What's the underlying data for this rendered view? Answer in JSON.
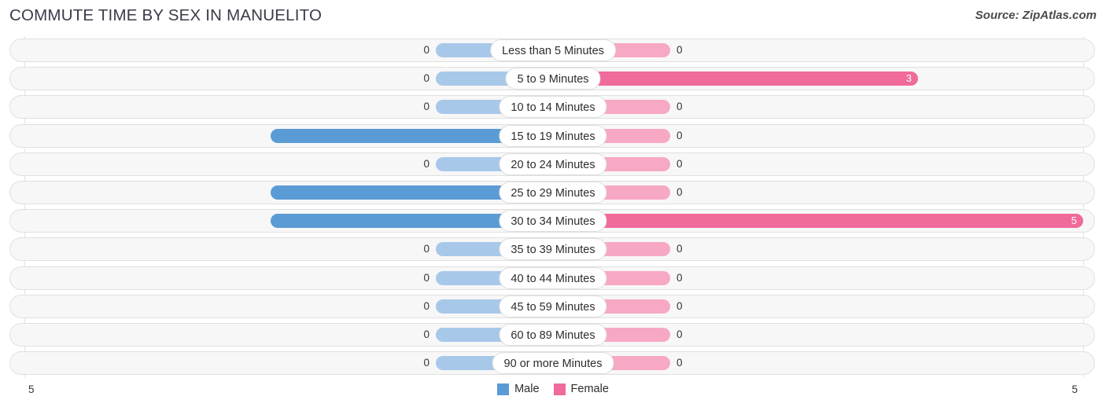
{
  "header": {
    "title": "COMMUTE TIME BY SEX IN MANUELITO",
    "source": "Source: ZipAtlas.com"
  },
  "legend": {
    "male_label": "Male",
    "female_label": "Female"
  },
  "axis": {
    "left_label": "5",
    "right_label": "5"
  },
  "colors": {
    "male_strong": "#5b9bd5",
    "male_light": "#a8c8ea",
    "female_strong": "#f06a9b",
    "female_light": "#f7a8c4",
    "track_fill": "#f7f7f7",
    "track_border": "#e0e0e0",
    "gridline": "#e3e3e3",
    "title": "#3a3a4a"
  },
  "chart_data": {
    "type": "bar",
    "title": "COMMUTE TIME BY SEX IN MANUELITO",
    "subtitle": "Source: ZipAtlas.com",
    "orientation": "horizontal-diverging",
    "xlabel": "",
    "ylabel": "",
    "xlim": [
      5,
      5
    ],
    "grid": true,
    "legend_position": "bottom-center",
    "categories": [
      "Less than 5 Minutes",
      "5 to 9 Minutes",
      "10 to 14 Minutes",
      "15 to 19 Minutes",
      "20 to 24 Minutes",
      "25 to 29 Minutes",
      "30 to 34 Minutes",
      "35 to 39 Minutes",
      "40 to 44 Minutes",
      "45 to 59 Minutes",
      "60 to 89 Minutes",
      "90 or more Minutes"
    ],
    "series": [
      {
        "name": "Male",
        "color": "#5b9bd5",
        "values": [
          0,
          0,
          0,
          2,
          0,
          2,
          2,
          0,
          0,
          0,
          0,
          0
        ]
      },
      {
        "name": "Female",
        "color": "#f06a9b",
        "values": [
          0,
          3,
          0,
          0,
          0,
          0,
          5,
          0,
          0,
          0,
          0,
          0
        ]
      }
    ]
  }
}
